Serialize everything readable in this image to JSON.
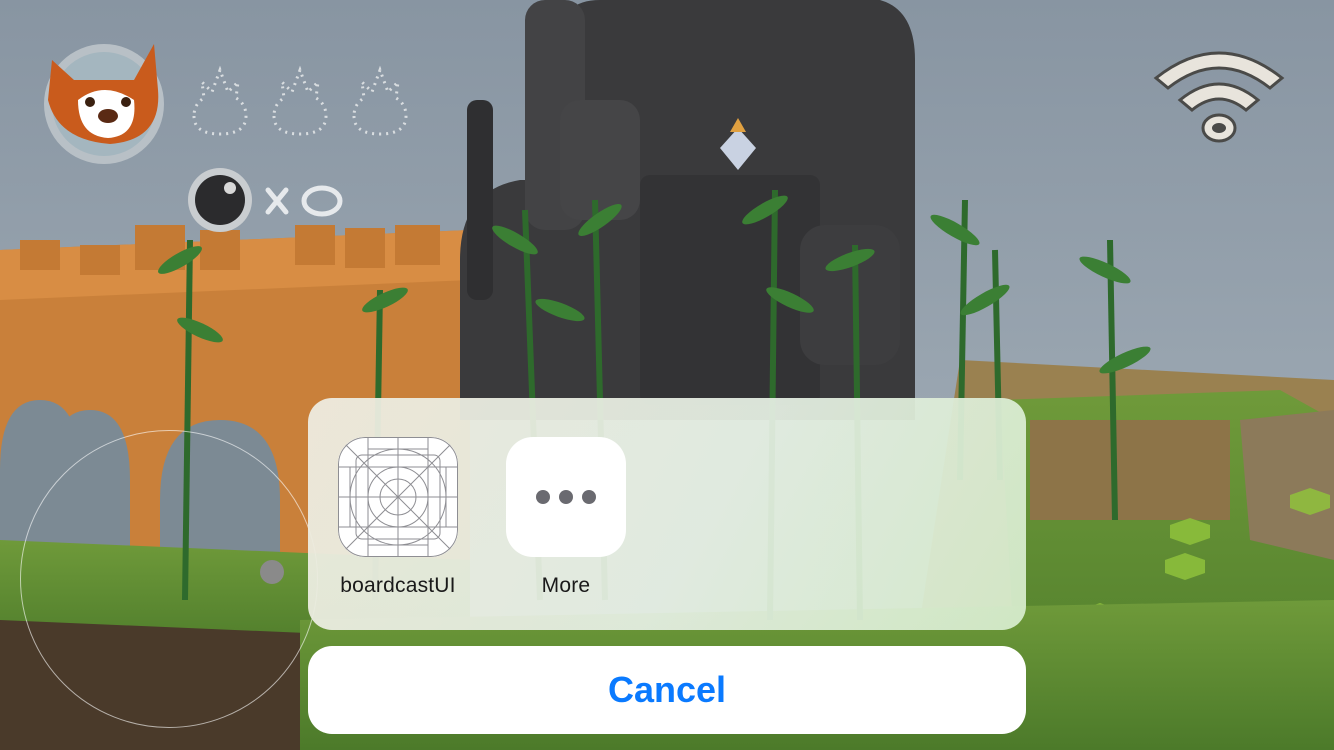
{
  "share_sheet": {
    "apps": [
      {
        "label": "boardcastUI",
        "icon": "app-template-grid-icon"
      },
      {
        "label": "More",
        "icon": "more-ellipsis-icon"
      }
    ],
    "cancel_label": "Cancel"
  },
  "hud": {
    "avatar_icon": "red-panda-icon",
    "lives_icons": [
      "spark-outline-icon",
      "spark-outline-icon",
      "spark-outline-icon"
    ],
    "bomb_icon": "bomb-icon",
    "connection_icon": "wifi-icon"
  },
  "colors": {
    "accent": "#0a7aff",
    "sheet_bg": "#e6ece0",
    "sky": "#8a9aa8"
  }
}
